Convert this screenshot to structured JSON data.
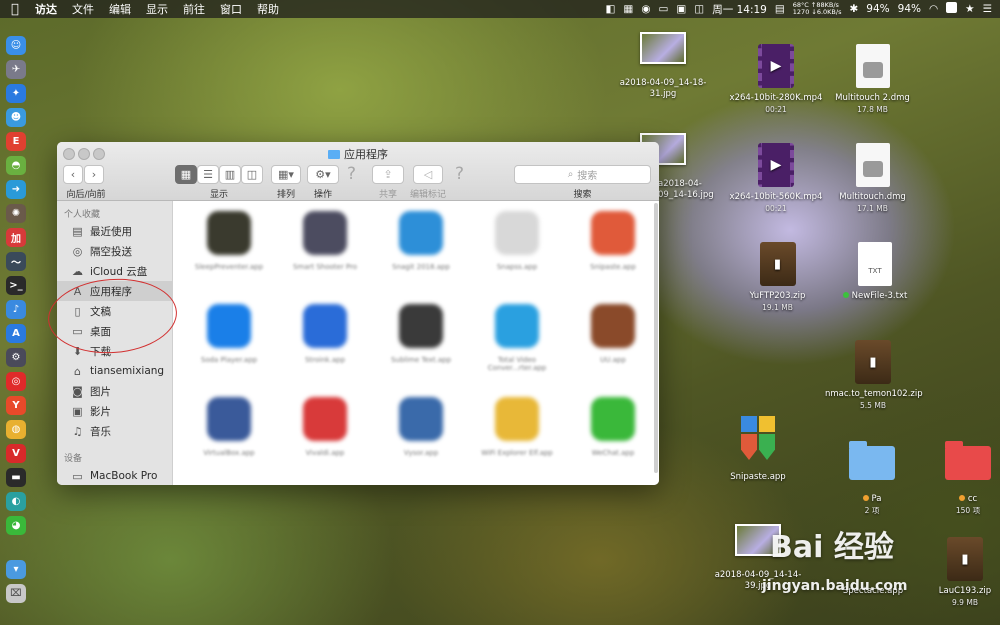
{
  "menubar": {
    "items": [
      "访达",
      "文件",
      "编辑",
      "显示",
      "前往",
      "窗口",
      "帮助"
    ],
    "net_up": "68°C ↑88KB/s",
    "net_down": "1270 ↓6.0KB/s",
    "datetime": "周一 14:19",
    "battery1": "94%",
    "battery2": "94%"
  },
  "window": {
    "title": "应用程序",
    "labels": {
      "nav": "向后/向前",
      "view": "显示",
      "arrange": "排列",
      "action": "操作",
      "share": "共享",
      "tags": "编辑标记",
      "search": "搜索"
    },
    "search_placeholder": "搜索"
  },
  "sidebar": {
    "favorites_header": "个人收藏",
    "devices_header": "设备",
    "items": [
      {
        "label": "最近使用",
        "icon": "recents-icon"
      },
      {
        "label": "隔空投送",
        "icon": "airdrop-icon"
      },
      {
        "label": "iCloud 云盘",
        "icon": "cloud-icon"
      },
      {
        "label": "应用程序",
        "icon": "applications-icon"
      },
      {
        "label": "文稿",
        "icon": "documents-icon"
      },
      {
        "label": "桌面",
        "icon": "desktop-icon"
      },
      {
        "label": "下载",
        "icon": "download-icon"
      },
      {
        "label": "tiansemixiang",
        "icon": "home-icon"
      },
      {
        "label": "图片",
        "icon": "camera-icon"
      },
      {
        "label": "影片",
        "icon": "film-icon"
      },
      {
        "label": "音乐",
        "icon": "music-icon"
      }
    ],
    "device": "MacBook Pro",
    "selected": "应用程序"
  },
  "apps": [
    {
      "label": "SleepPreventer.app",
      "color": "#3a3a2e"
    },
    {
      "label": "Smart Shooter Pro",
      "color": "#4c4c60"
    },
    {
      "label": "Snagit 2018.app",
      "color": "#2d8fd8"
    },
    {
      "label": "Snapss.app",
      "color": "#d8d8d8"
    },
    {
      "label": "Snipaste.app",
      "color": "#e05a3a"
    },
    {
      "label": "Soda Player.app",
      "color": "#1a7fe8"
    },
    {
      "label": "Stroink.app",
      "color": "#2a6cd8"
    },
    {
      "label": "Sublime Text.app",
      "color": "#3a3a3a"
    },
    {
      "label": "Total Video Conver...rter.app",
      "color": "#2aa0e0"
    },
    {
      "label": "UU.app",
      "color": "#8a4a2a"
    },
    {
      "label": "VirtualBox.app",
      "color": "#3a5a9a"
    },
    {
      "label": "Vivaldi.app",
      "color": "#d83a3a"
    },
    {
      "label": "Vysor.app",
      "color": "#3a6aaa"
    },
    {
      "label": "WiFi Explorer Elf.app",
      "color": "#e8b838"
    },
    {
      "label": "WeChat.app",
      "color": "#3ab83a"
    }
  ],
  "desktop": [
    {
      "name": "a2018-04-09_14-18-31.jpg"
    },
    {
      "name": "x264-10bit-280K.mp4",
      "sub": "00:21"
    },
    {
      "name": "Multitouch 2.dmg",
      "sub": "17.8 MB"
    },
    {
      "name": "a2018-04-09_14-16.jpg"
    },
    {
      "name": "x264-10bit-560K.mp4",
      "sub": "00:21"
    },
    {
      "name": "Multitouch.dmg",
      "sub": "17.1 MB"
    },
    {
      "name": "YuFTP203.zip",
      "sub": "19.1 MB"
    },
    {
      "name": "NewFile-3.txt",
      "dot": "#3cc23c"
    },
    {
      "name": "nmac.to_temon102.zip",
      "sub": "5.5 MB"
    },
    {
      "name": "Snipaste.app"
    },
    {
      "name": "Pa",
      "sub": "2 项",
      "dot": "#f0a030"
    },
    {
      "name": "cc",
      "sub": "150 项",
      "dot": "#f0a030"
    },
    {
      "name": "a2018-04-09_14-14-39.jpg"
    },
    {
      "name": "Spectacle.app"
    },
    {
      "name": "LauC193.zip",
      "sub": "9.9 MB"
    }
  ],
  "txt_label": "TXT",
  "watermark": {
    "brand": "Bai 经验",
    "url": "jingyan.baidu.com"
  }
}
